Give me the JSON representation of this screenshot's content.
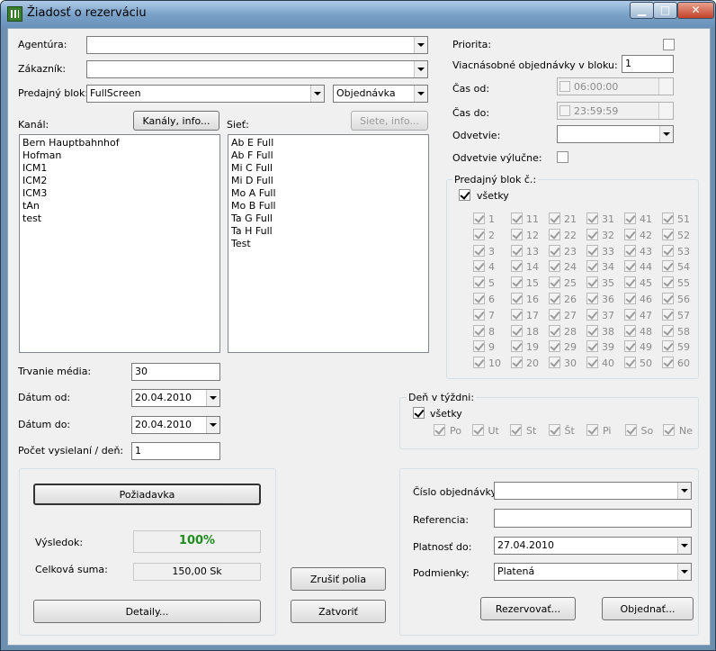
{
  "window": {
    "title": "Žiadosť o rezerváciu",
    "min": "▁",
    "max": "□",
    "close": "✕"
  },
  "left": {
    "agentura_label": "Agentúra:",
    "agentura_value": "",
    "zakaznik_label": "Zákazník:",
    "zakaznik_value": "",
    "predajny_blok_label": "Predajný blok:",
    "predajny_blok_value": "FullScreen",
    "typ_value": "Objednávka",
    "kanal_label": "Kanál:",
    "kanaly_button": "Kanály, info...",
    "siet_label": "Sieť:",
    "siete_button": "Siete, info...",
    "kanaly": [
      "Bern Hauptbahnhof",
      "Hofman",
      "ICM1",
      "ICM2",
      "ICM3",
      "tAn",
      "test"
    ],
    "siete": [
      "Ab E Full",
      "Ab F Full",
      "Mi C Full",
      "Mi D Full",
      "Mo A Full",
      "Mo B Full",
      "Ta G Full",
      "Ta H Full",
      "Test"
    ],
    "trvanie_label": "Trvanie média:",
    "trvanie_value": "30",
    "datum_od_label": "Dátum od:",
    "datum_od_value": "20.04.2010",
    "datum_do_label": "Dátum do:",
    "datum_do_value": "20.04.2010",
    "pocet_label": "Počet vysielaní / deň:",
    "pocet_value": "1"
  },
  "result": {
    "poziadavka_button": "Požiadavka",
    "vysledok_label": "Výsledok:",
    "vysledok_value": "100%",
    "suma_label": "Celková suma:",
    "suma_value": "150,00 Sk",
    "detaily_button": "Detaily..."
  },
  "middle": {
    "zrusit_button": "Zrušiť polia",
    "zatvorit_button": "Zatvoriť"
  },
  "right": {
    "priorita_label": "Priorita:",
    "viacnasobne_label": "Viacnásobné objednávky v bloku:",
    "viacnasobne_value": "1",
    "cas_od_label": "Čas od:",
    "cas_od_value": "06:00:00",
    "cas_do_label": "Čas do:",
    "cas_do_value": "23:59:59",
    "odvetvie_label": "Odvetvie:",
    "odvetvie_value": "",
    "odvetvie_vylucne_label": "Odvetvie výlučne:",
    "blok_group_label": "Predajný blok č.:",
    "vsetky_label": "všetky",
    "den_group_label": "Deň v týždni:",
    "den_vsetky_label": "všetky",
    "dni": [
      "Po",
      "Ut",
      "St",
      "Št",
      "Pi",
      "So",
      "Ne"
    ]
  },
  "order": {
    "cislo_label": "Číslo objednávky:",
    "cislo_value": "",
    "referencia_label": "Referencia:",
    "referencia_value": "",
    "platnost_label": "Platnosť do:",
    "platnost_value": "27.04.2010",
    "podmienky_label": "Podmienky:",
    "podmienky_value": "Platená",
    "rezervovat_button": "Rezervovať...",
    "objednat_button": "Objednať..."
  },
  "colors": {
    "result_green": "#1e8c1e"
  }
}
